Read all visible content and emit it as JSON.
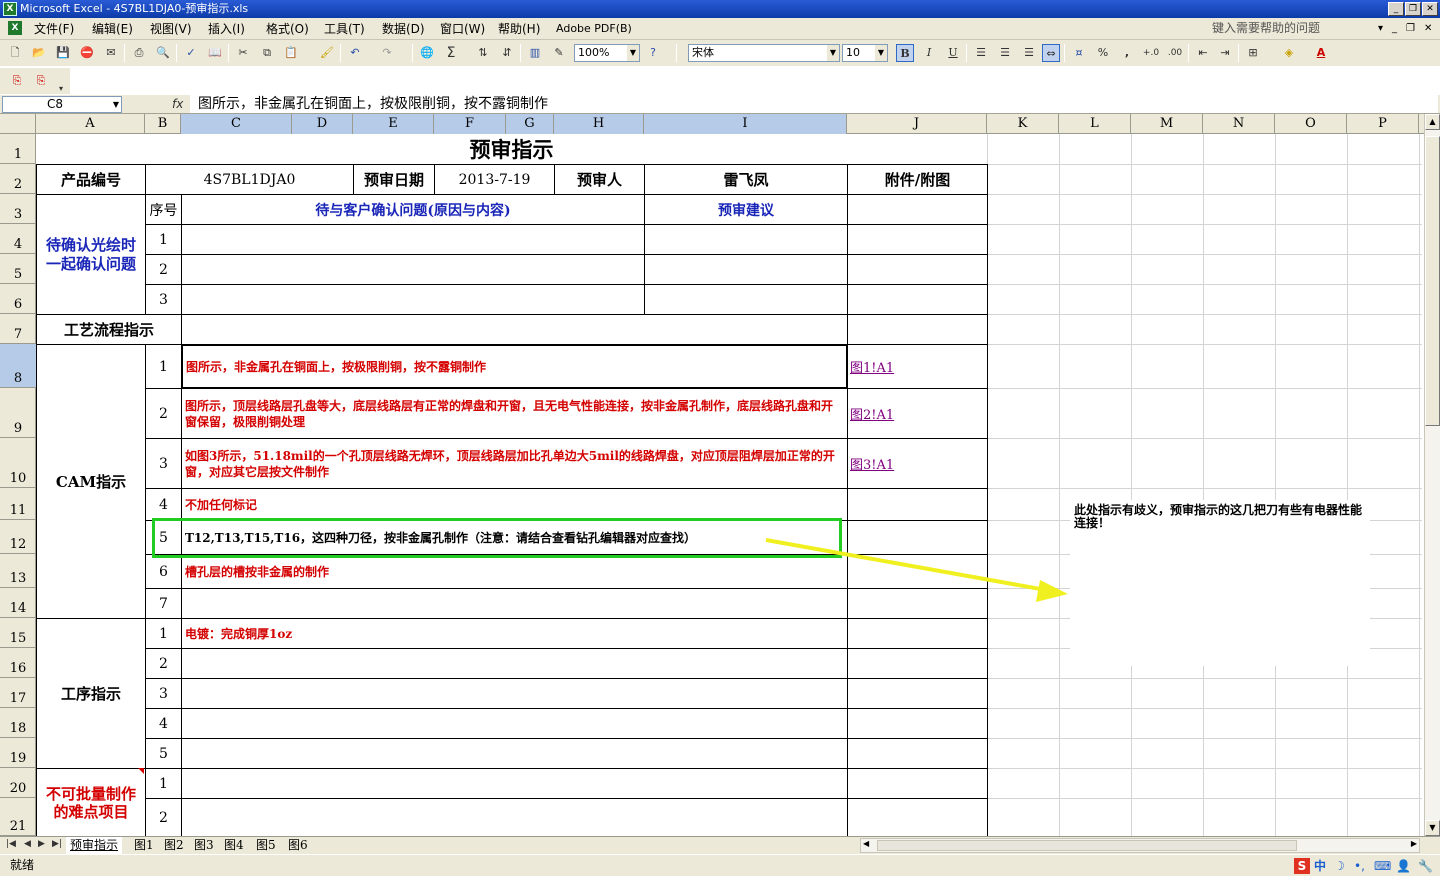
{
  "window": {
    "title": "Microsoft Excel - 4S7BL1DJA0-预审指示.xls",
    "help_placeholder": "键入需要帮助的问题",
    "minimize_glyph": "_",
    "restore_glyph": "❐",
    "close_glyph": "✕"
  },
  "menu": [
    "文件(F)",
    "编辑(E)",
    "视图(V)",
    "插入(I)",
    "格式(O)",
    "工具(T)",
    "数据(D)",
    "窗口(W)",
    "帮助(H)",
    "Adobe PDF(B)"
  ],
  "toolbar": {
    "zoom": "100%",
    "font_name": "宋体",
    "font_size": "10",
    "bold": "B",
    "italic": "I",
    "underline": "U",
    "percent": "%",
    "comma": ",",
    "sum": "Σ"
  },
  "formula_bar": {
    "cell_ref": "C8",
    "fx": "fx",
    "content": "图所示，非金属孔在铜面上，按极限削铜，按不露铜制作"
  },
  "columns": [
    "A",
    "B",
    "C",
    "D",
    "E",
    "F",
    "G",
    "H",
    "I",
    "J",
    "K",
    "L",
    "M",
    "N",
    "O",
    "P"
  ],
  "rows": [
    "1",
    "2",
    "3",
    "4",
    "5",
    "6",
    "7",
    "8",
    "9",
    "10",
    "11",
    "12",
    "13",
    "14",
    "15",
    "16",
    "17",
    "18",
    "19",
    "20",
    "21"
  ],
  "sheet": {
    "title": "预审指示",
    "product_label": "产品编号",
    "product_value": "4S7BL1DJA0",
    "date_label": "预审日期",
    "date_value": "2013-7-19",
    "reviewer_label": "预审人",
    "reviewer_value": "雷飞凤",
    "attachment_label": "附件/附图",
    "confirm_section": "待确认光绘时一起确认问题",
    "seq_label": "序号",
    "question_header": "待与客户确认问题(原因与内容)",
    "suggestion_header": "预审建议",
    "confirm_seq": [
      "1",
      "2",
      "3"
    ],
    "process_label": "工艺流程指示",
    "cam_label": "CAM指示",
    "cam_items": [
      {
        "n": "1",
        "text": "图所示，非金属孔在铜面上，按极限削铜，按不露铜制作",
        "link": "图1!A1"
      },
      {
        "n": "2",
        "text": "图所示，顶层线路层孔盘等大，底层线路层有正常的焊盘和开窗，且无电气性能连接，按非金属孔制作，底层线路孔盘和开窗保留，极限削铜处理",
        "link": "图2!A1"
      },
      {
        "n": "3",
        "text": "如图3所示，51.18mil的一个孔顶层线路无焊环，顶层线路层加比孔单边大5mil的线路焊盘，对应顶层阻焊层加正常的开窗，对应其它层按文件制作",
        "link": "图3!A1"
      },
      {
        "n": "4",
        "text": "不加任何标记",
        "link": ""
      },
      {
        "n": "5",
        "text": "T12,T13,T15,T16，这四种刀径，按非金属孔制作（注意：请结合查看钻孔编辑器对应查找）",
        "link": ""
      },
      {
        "n": "6",
        "text": "槽孔层的槽按非金属的制作",
        "link": ""
      },
      {
        "n": "7",
        "text": "",
        "link": ""
      }
    ],
    "procedure_label": "工序指示",
    "procedure_items": [
      {
        "n": "1",
        "text": "电镀：完成铜厚1oz"
      },
      {
        "n": "2",
        "text": ""
      },
      {
        "n": "3",
        "text": ""
      },
      {
        "n": "4",
        "text": ""
      },
      {
        "n": "5",
        "text": ""
      }
    ],
    "difficult_label": "不可批量制作的难点项目",
    "difficult_items": [
      "1",
      "2"
    ]
  },
  "annotation": {
    "note": "此处指示有歧义，预审指示的这几把刀有些有电器性能连接！",
    "highlight_color": "#22cc22",
    "arrow_color": "#f0f020"
  },
  "tabs": [
    "预审指示",
    "图1",
    "图2",
    "图3",
    "图4",
    "图5",
    "图6"
  ],
  "status": {
    "ready": "就绪",
    "ime_label": "中"
  }
}
